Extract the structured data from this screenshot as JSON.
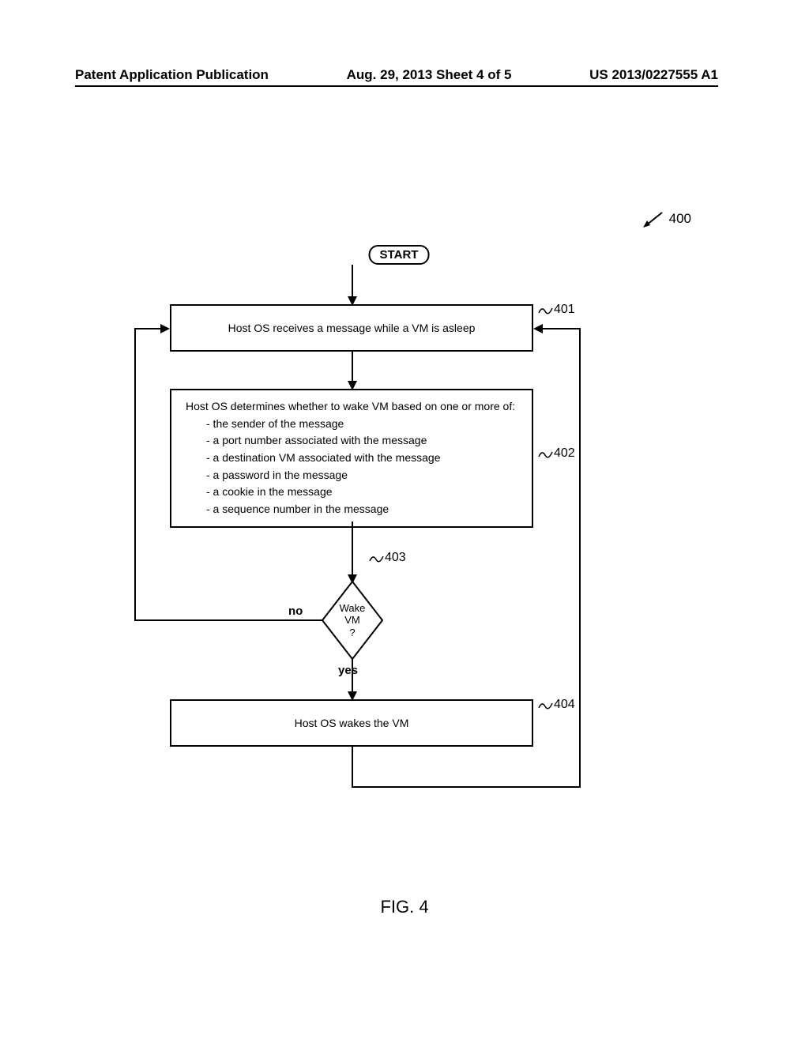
{
  "header": {
    "left": "Patent Application Publication",
    "center": "Aug. 29, 2013  Sheet 4 of 5",
    "right": "US 2013/0227555 A1"
  },
  "diagram": {
    "ref_main": "400",
    "start": "START",
    "box401": {
      "ref": "401",
      "text": "Host OS receives a message while a VM is asleep"
    },
    "box402": {
      "ref": "402",
      "heading": "Host OS determines whether to wake VM based on one or more of:",
      "items": [
        "- the sender of the message",
        "- a port number associated with the message",
        "- a destination VM associated with the message",
        "- a password in the message",
        "- a cookie in the message",
        "- a sequence number in the message"
      ]
    },
    "decision": {
      "ref": "403",
      "line1": "Wake",
      "line2": "VM",
      "line3": "?",
      "no": "no",
      "yes": "yes"
    },
    "box404": {
      "ref": "404",
      "text": "Host OS wakes the VM"
    }
  },
  "figure_label": "FIG. 4"
}
